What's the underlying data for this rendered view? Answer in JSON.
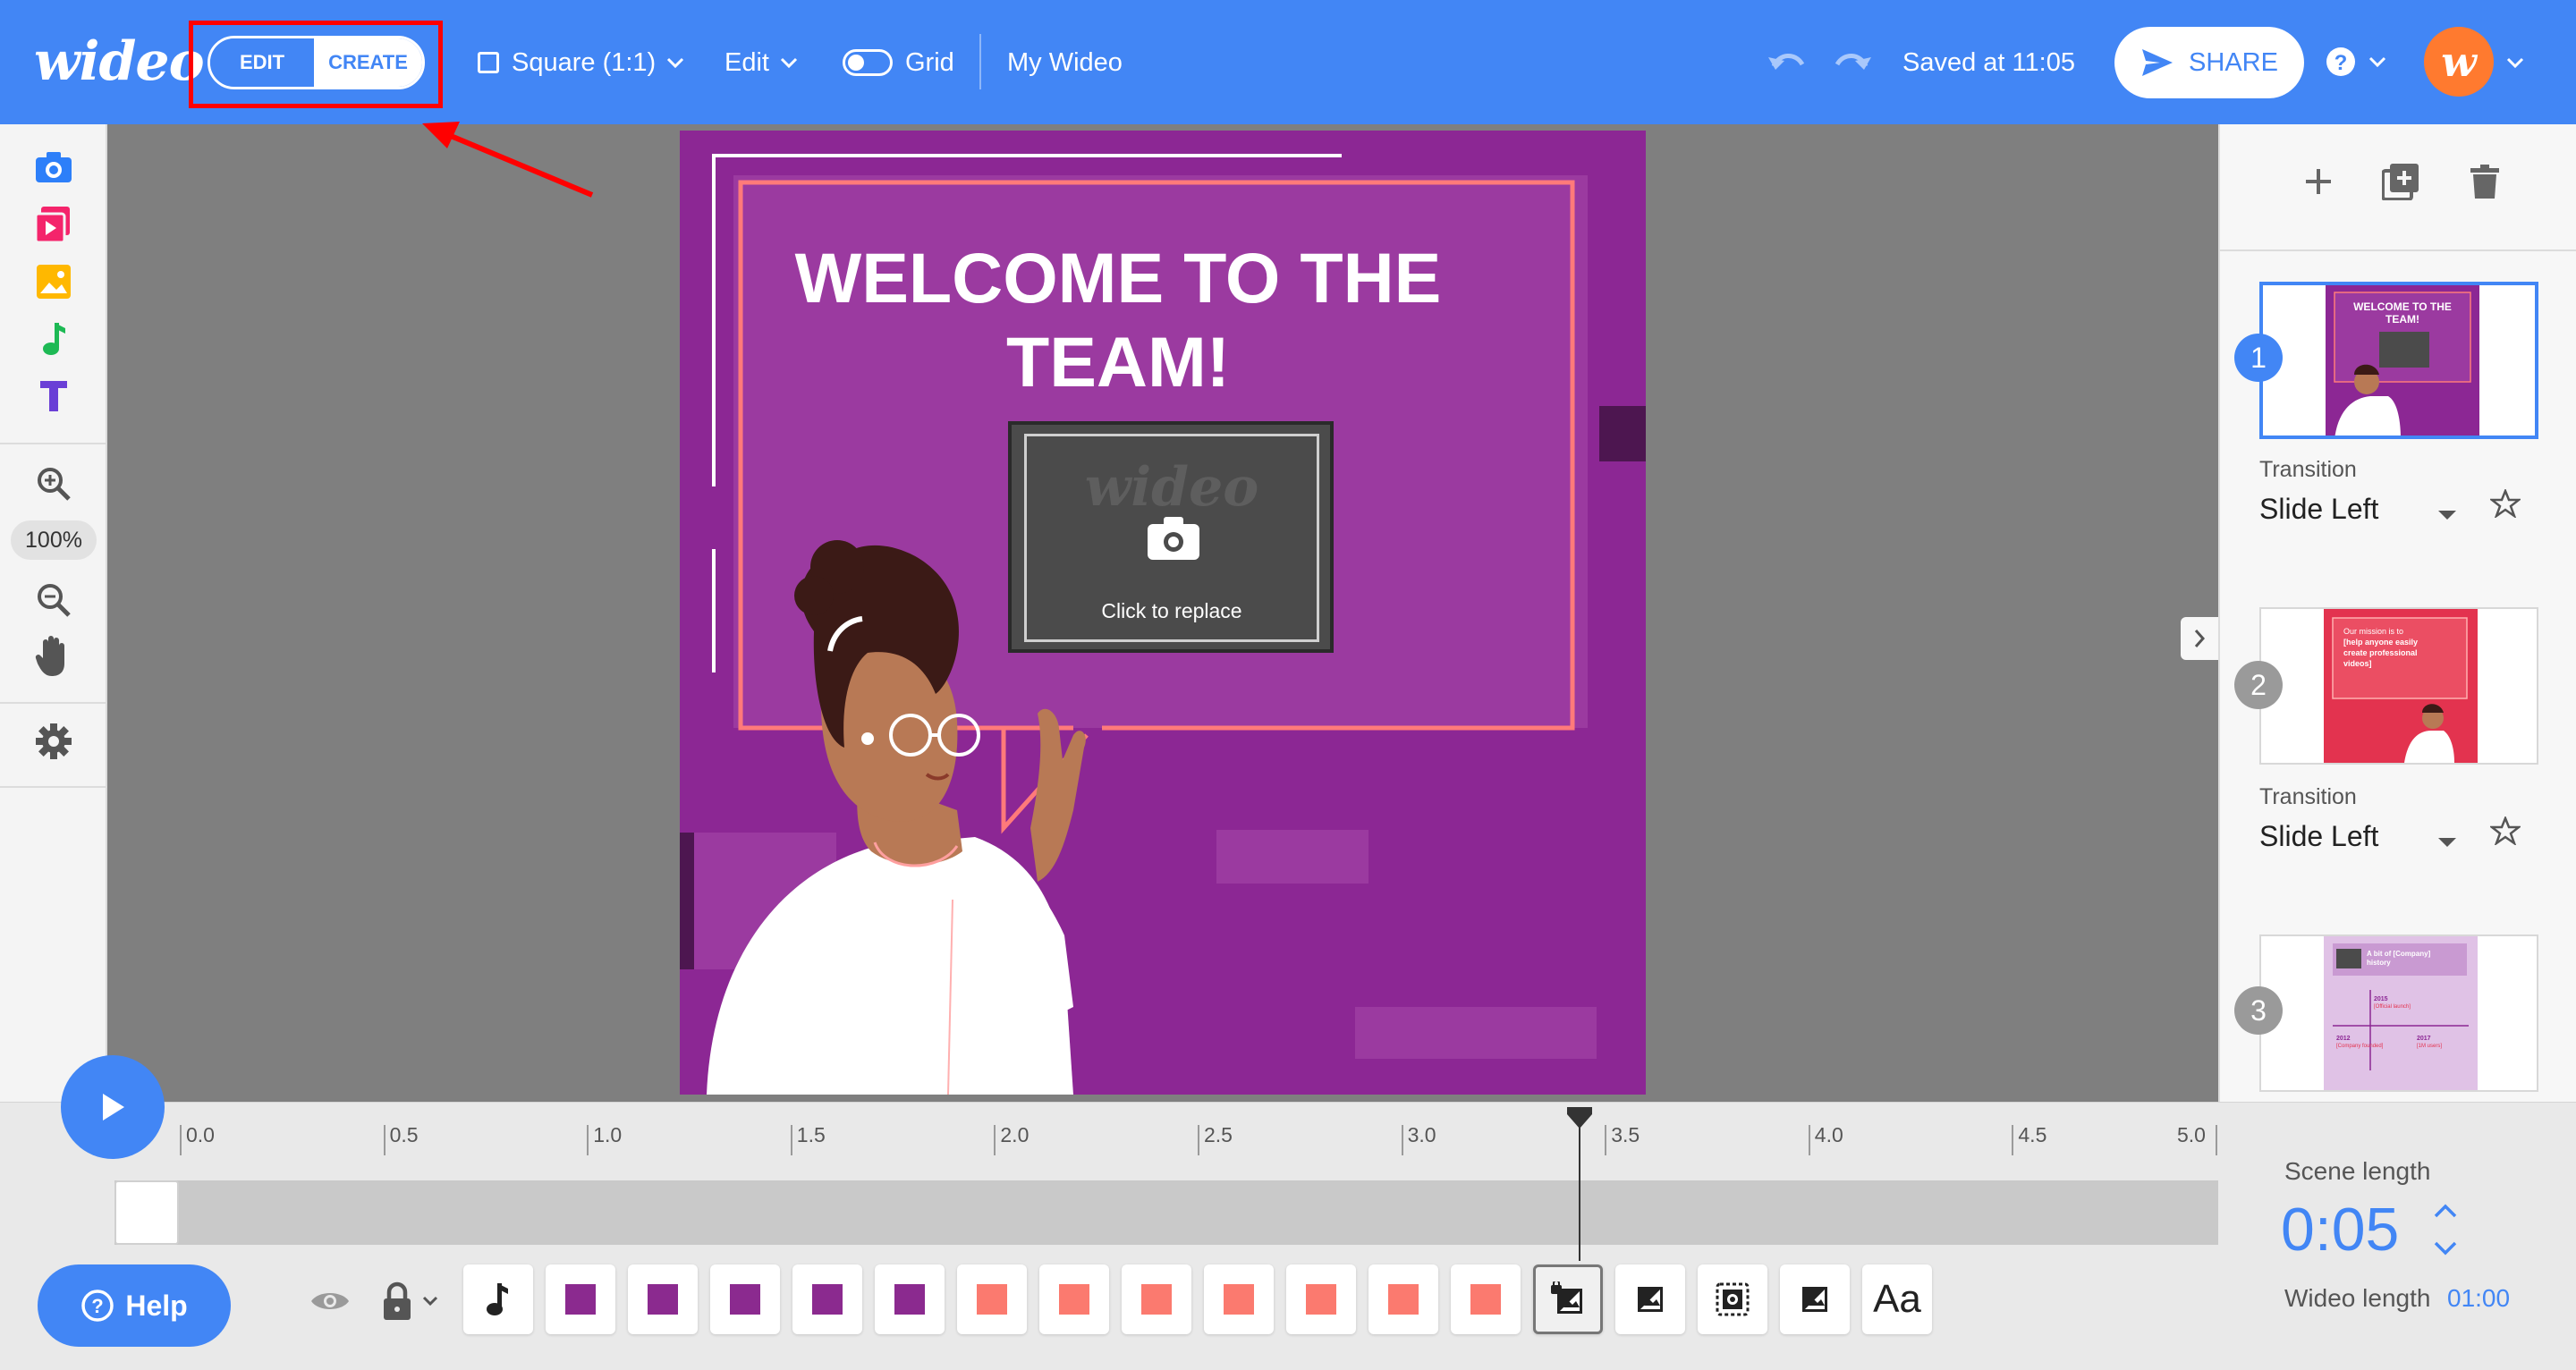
{
  "app": {
    "logo": "wideo"
  },
  "toolbar": {
    "mode_edit": "EDIT",
    "mode_create": "CREATE",
    "format_label": "Square (1:1)",
    "edit_menu": "Edit",
    "grid_label": "Grid",
    "grid_enabled": false,
    "project_title": "My Wideo",
    "saved_status": "Saved at 11:05",
    "share_label": "SHARE",
    "avatar_initial": "w"
  },
  "left_tools": {
    "zoom_level": "100%",
    "icons": [
      "camera-icon",
      "video-icon",
      "image-icon",
      "music-icon",
      "text-icon",
      "zoom-in-icon",
      "zoom-out-icon",
      "hand-icon",
      "settings-icon"
    ]
  },
  "canvas": {
    "title": "WELCOME TO THE TEAM!",
    "placeholder_watermark": "wideo",
    "placeholder_label": "Click to replace",
    "background_color": "#8c2794"
  },
  "scenes": [
    {
      "number": "1",
      "active": true,
      "thumb_text": "WELCOME TO THE TEAM!",
      "transition_label": "Transition",
      "transition": "Slide Left"
    },
    {
      "number": "2",
      "active": false,
      "thumb_text": "Our mission is to [help anyone easily create professional videos]",
      "transition_label": "Transition",
      "transition": "Slide Left"
    },
    {
      "number": "3",
      "active": false,
      "thumb_text": "A bit of [Company] history",
      "thumb_details": [
        "2015",
        "[Official launch]",
        "2012",
        "[Company founded & first investment]",
        "2017",
        "[1M users]"
      ]
    }
  ],
  "timeline": {
    "ticks": [
      "0.0",
      "0.5",
      "1.0",
      "1.5",
      "2.0",
      "2.5",
      "3.0",
      "3.5",
      "4.0",
      "4.5",
      "5.0"
    ],
    "playhead_position_seconds": 3.4,
    "help_label": "Help",
    "layers": [
      "music",
      "purple",
      "purple",
      "purple",
      "purple",
      "purple",
      "coral",
      "coral",
      "coral",
      "coral",
      "coral",
      "coral",
      "coral",
      "image-locked",
      "image",
      "image-frame",
      "image",
      "text"
    ],
    "text_layer_label": "Aa",
    "scene_length_label": "Scene length",
    "scene_length": "0:05",
    "wideo_length_label": "Wideo length",
    "wideo_length": "01:00"
  },
  "colors": {
    "brand_blue": "#4286f5",
    "purple_layer": "#8b2a8f",
    "coral_layer": "#fb7a6f",
    "annotation_red": "#ff0000"
  }
}
